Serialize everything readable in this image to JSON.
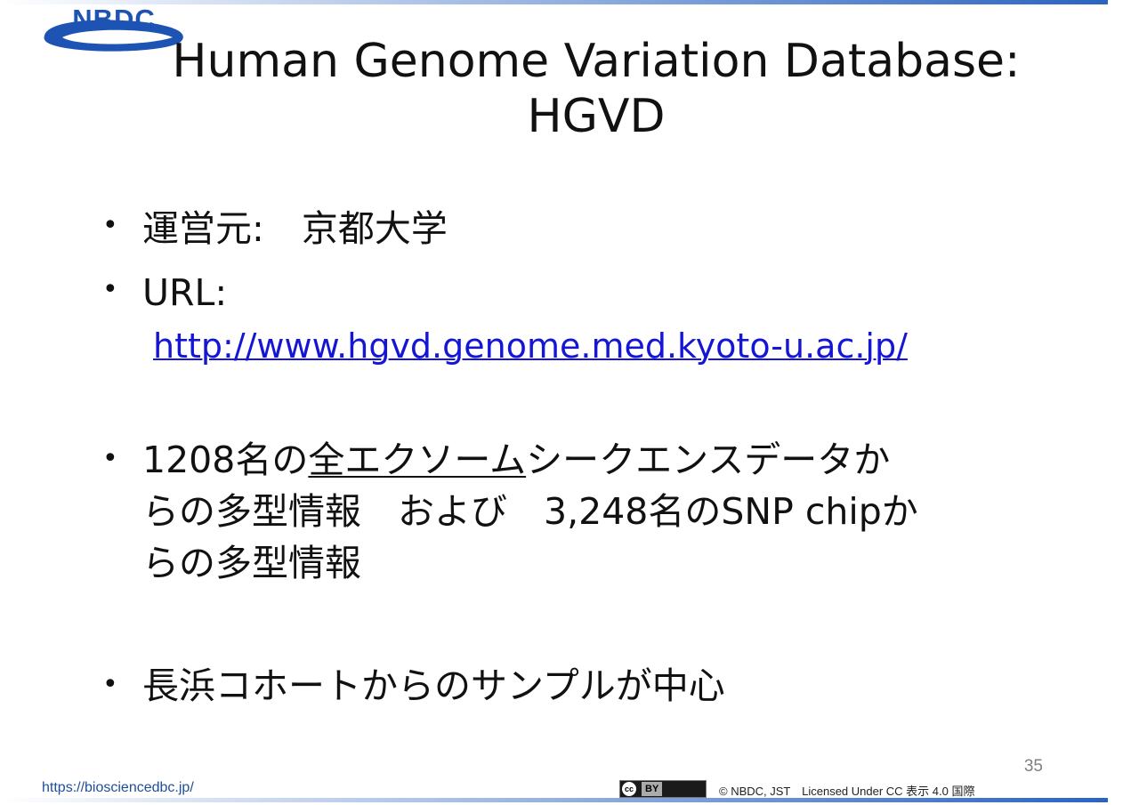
{
  "logo": {
    "text": "NBDC"
  },
  "title": {
    "line1": "Human Genome Variation Database:",
    "line2": "HGVD"
  },
  "bullets": {
    "operator": {
      "label": "運営元:",
      "value": "京都大学"
    },
    "url": {
      "label": "URL:",
      "link": "http://www.hgvd.genome.med.kyoto-u.ac.jp/"
    },
    "data": {
      "line1_a": "1208名の",
      "line1_underlined": "全エクソーム",
      "line1_b": "シークエンスデータか",
      "line2": "らの多型情報　および　3,248名のSNP chipか",
      "line3": "らの多型情報"
    },
    "samples": {
      "text": "長浜コホートからのサンプルが中心"
    }
  },
  "footer": {
    "page_number": "35",
    "site_url": "https://biosciencedbc.jp/",
    "cc_label": "cc",
    "by_label": "BY",
    "license": "© NBDC, JST　Licensed Under CC 表示 4.0 国際"
  },
  "colors": {
    "accent": "#2a63c2",
    "logo": "#1d54b3",
    "link": "#1515d6"
  }
}
